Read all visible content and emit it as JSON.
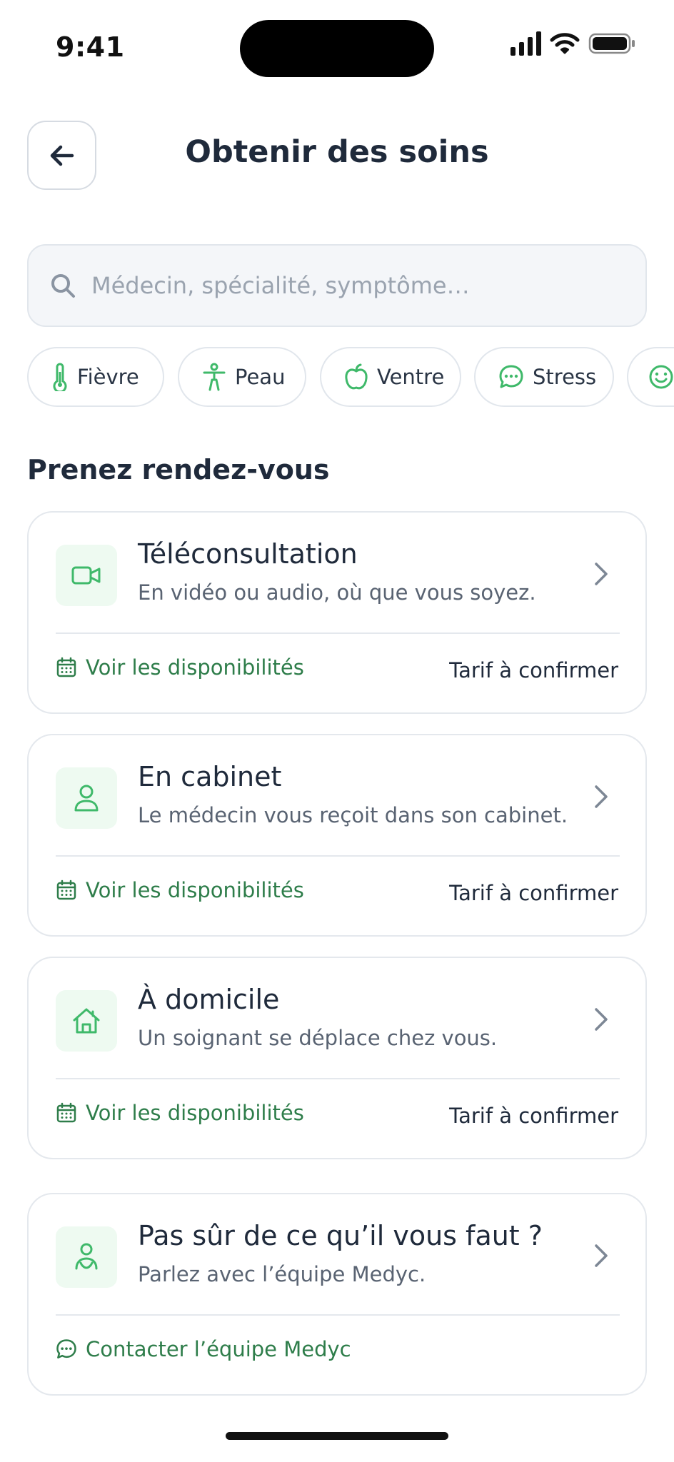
{
  "status_bar": {
    "time": "9:41"
  },
  "header": {
    "title": "Obtenir des soins"
  },
  "search": {
    "placeholder": "Médecin, spécialité, symptôme…"
  },
  "chips": [
    {
      "label": "Fièvre",
      "icon": "thermometer-icon"
    },
    {
      "label": "Peau",
      "icon": "body-icon"
    },
    {
      "label": "Ventre",
      "icon": "apple-icon"
    },
    {
      "label": "Stress",
      "icon": "chat-bubble-icon"
    },
    {
      "label": "",
      "icon": "smiley-icon"
    }
  ],
  "section": {
    "title": "Prenez rendez-vous"
  },
  "cards": [
    {
      "title": "Téléconsultation",
      "subtitle": "En vidéo ou audio, où que vous soyez.",
      "icon": "video-camera-icon",
      "link": "Voir les disponibilités",
      "price": "Tarif à confirmer"
    },
    {
      "title": "En cabinet",
      "subtitle": "Le médecin vous reçoit dans son cabinet.",
      "icon": "person-icon",
      "link": "Voir les disponibilités",
      "price": "Tarif à confirmer"
    },
    {
      "title": "À domicile",
      "subtitle": "Un soignant se déplace chez vous.",
      "icon": "house-icon",
      "link": "Voir les disponibilités",
      "price": "Tarif à confirmer"
    }
  ],
  "help_card": {
    "title": "Pas sûr de ce qu’il vous faut ?",
    "subtitle": "Parlez avec l’équipe Medyc.",
    "icon": "support-person-icon",
    "link": "Contacter l’équipe Medyc"
  },
  "colors": {
    "accent_green": "#2e7d4a",
    "icon_green": "#3fb96a",
    "icon_bg": "#eefaf1",
    "title_text": "#1f2a3b",
    "border": "#e4e8ed"
  }
}
